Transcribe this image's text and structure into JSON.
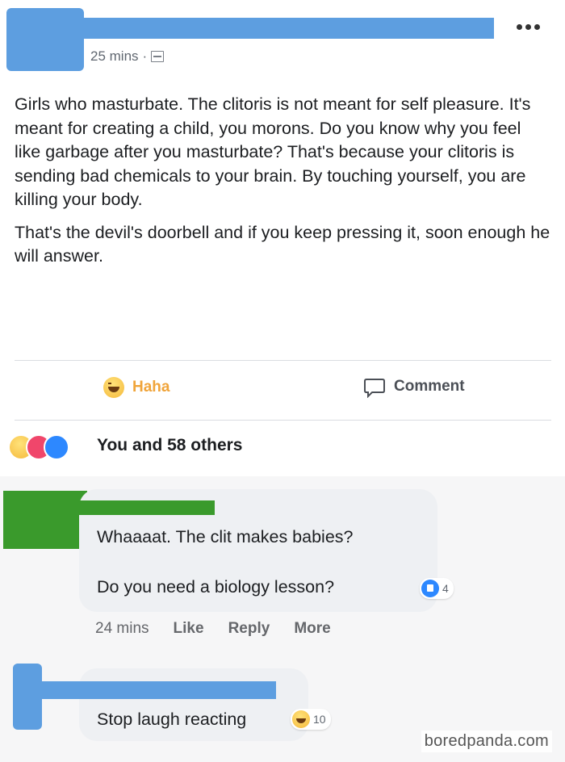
{
  "post": {
    "time": "25 mins",
    "separator": "·",
    "paragraphs": [
      "Girls who masturbate. The clitoris is not meant for self pleasure. It's meant for creating a child, you morons. Do you know why you feel like garbage after you masturbate? That's because your clitoris is sending bad chemicals to your brain. By touching yourself, you are killing your body.",
      "That's the devil's doorbell and if you keep pressing it, soon enough he will answer."
    ],
    "actions": {
      "haha_label": "Haha",
      "comment_label": "Comment"
    },
    "reactions_summary": "You and 58 others"
  },
  "comments": [
    {
      "lines": [
        "Whaaaat. The clit makes babies?",
        "Do you need a biology lesson?"
      ],
      "likes": "4",
      "time": "24 mins",
      "like_label": "Like",
      "reply_label": "Reply",
      "more_label": "More"
    },
    {
      "lines": [
        "Stop laugh reacting"
      ],
      "reactions": "10"
    }
  ],
  "watermark": "boredpanda.com",
  "colors": {
    "redaction_blue": "#5d9ee0",
    "redaction_green": "#3a9a2c",
    "haha_text": "#f0a43a",
    "like_blue": "#2d88ff",
    "love_pink": "#f0466b"
  },
  "icons": [
    "more-options-icon",
    "globe-icon",
    "haha-icon",
    "comment-icon",
    "like-icon",
    "love-icon"
  ]
}
